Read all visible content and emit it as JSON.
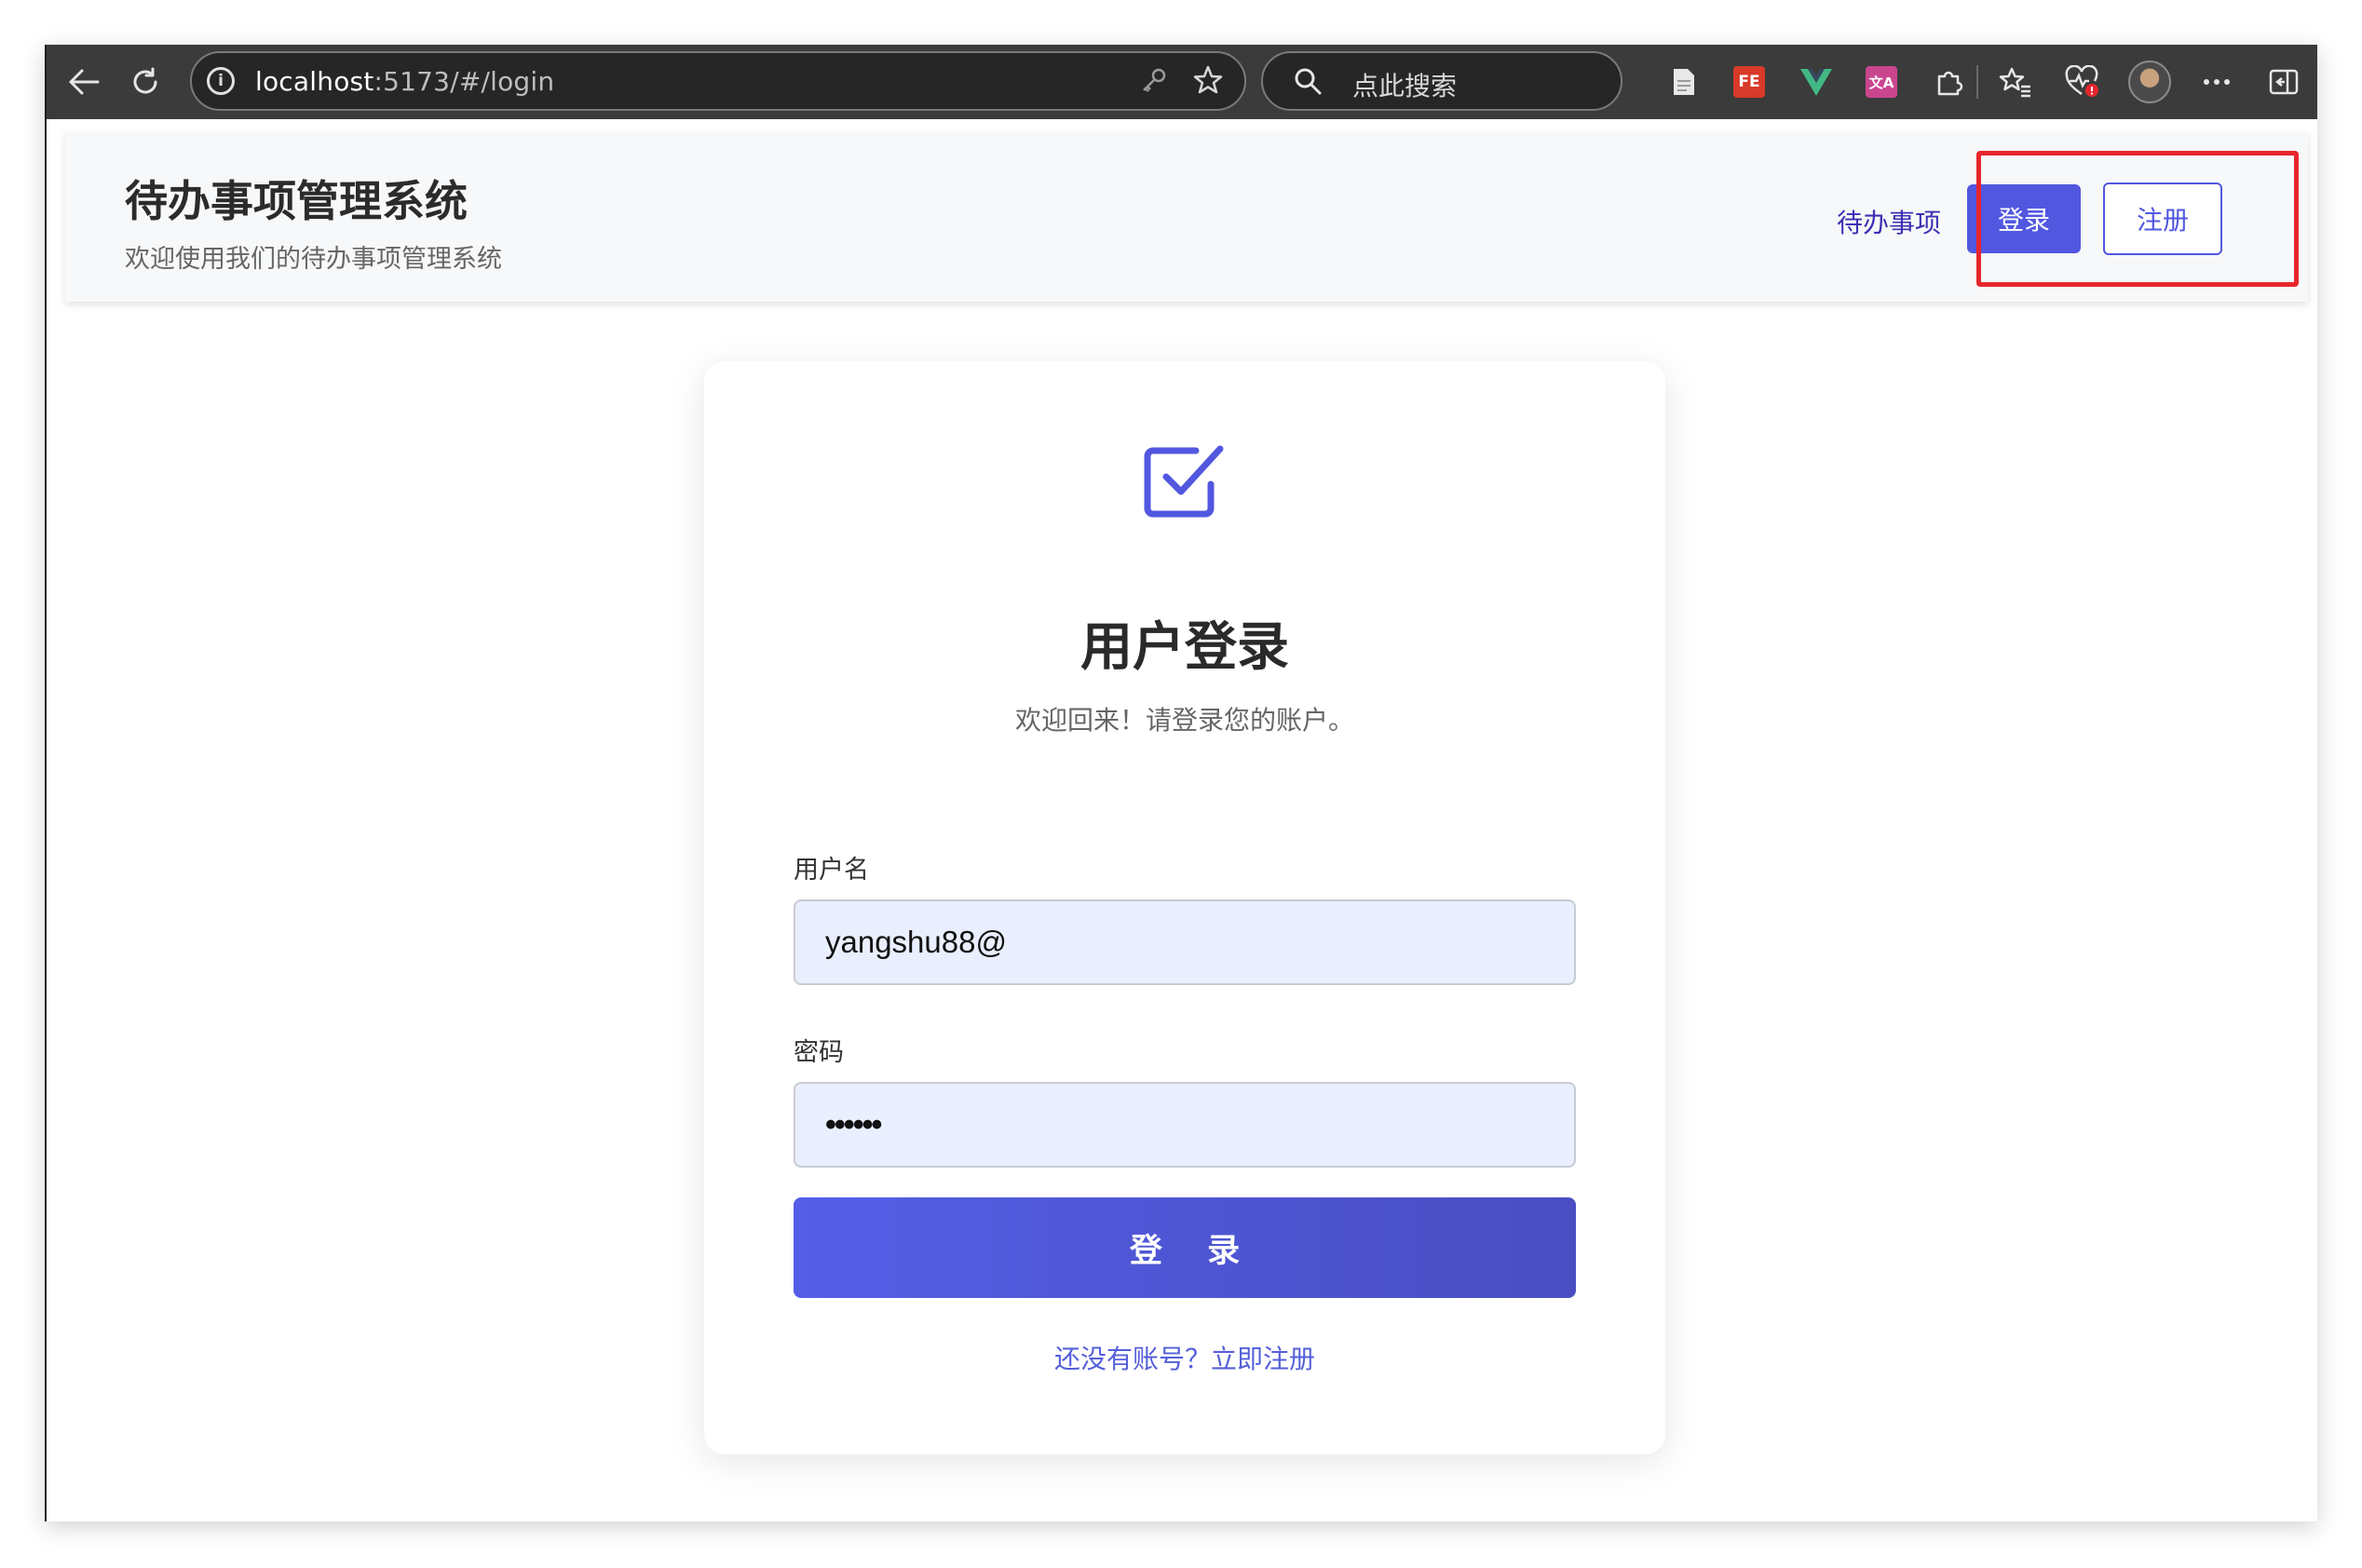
{
  "browser": {
    "url_host": "localhost",
    "url_rest": ":5173/#/login",
    "search_placeholder": "点此搜索",
    "icons": [
      "back-icon",
      "reload-icon",
      "info-icon",
      "key-icon",
      "star-icon",
      "search-icon",
      "page-icon",
      "fe-extension-icon",
      "vue-devtools-icon",
      "translate-extension-icon",
      "extensions-icon",
      "favorites-icon",
      "performance-icon",
      "profile-avatar",
      "more-icon",
      "sidebar-icon"
    ],
    "ext_labels": {
      "fe": "FE",
      "translate": "文A"
    }
  },
  "header": {
    "title": "待办事项管理系统",
    "subtitle": "欢迎使用我们的待办事项管理系统",
    "nav_todo": "待办事项",
    "login_button": "登录",
    "register_button": "注册"
  },
  "login": {
    "title": "用户登录",
    "subtitle": "欢迎回来！请登录您的账户。",
    "username_label": "用户名",
    "username_value": "yangshu88@",
    "password_label": "密码",
    "password_value": "••••••",
    "submit_label": "登 录",
    "register_link": "还没有账号？立即注册"
  },
  "colors": {
    "primary": "#5257e0",
    "highlight": "#e8262d",
    "input_bg": "#e9effe",
    "chrome_bg": "#3b3b3b"
  }
}
